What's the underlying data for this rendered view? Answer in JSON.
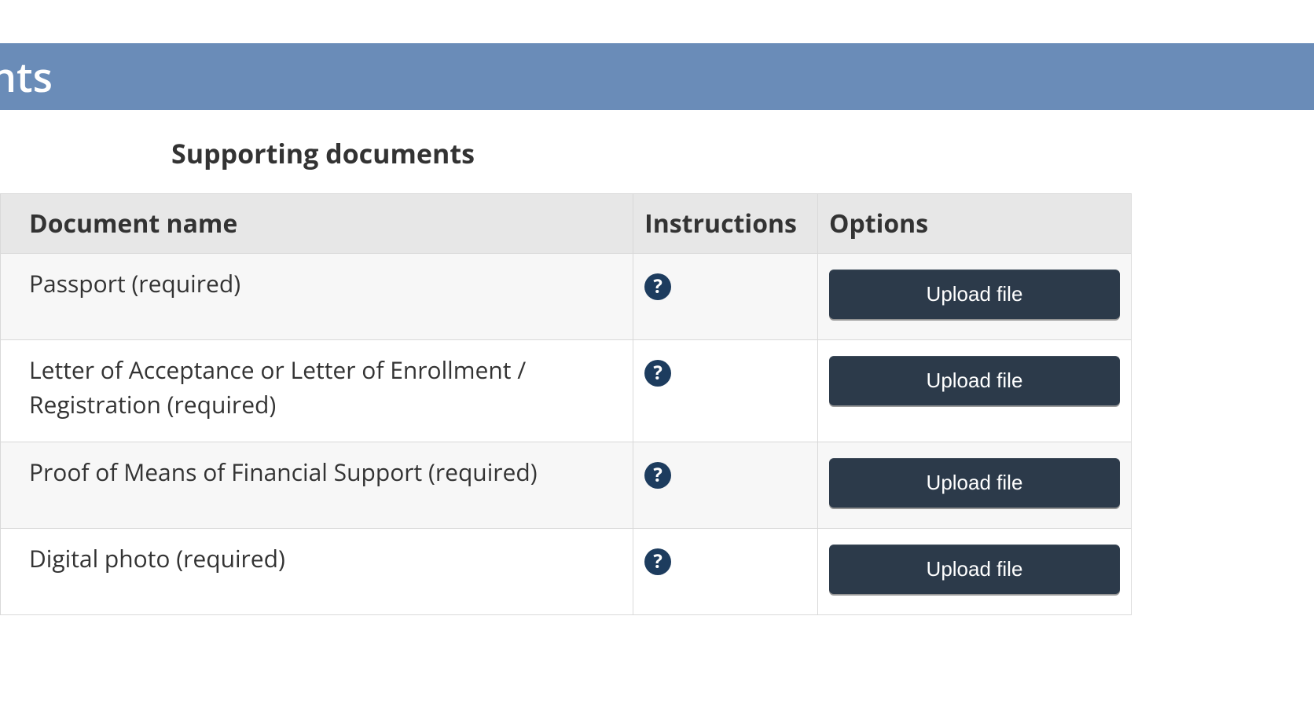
{
  "header": {
    "title_fragment": "nts"
  },
  "section": {
    "title": "Supporting documents"
  },
  "table": {
    "columns": {
      "document_name": "Document name",
      "instructions": "Instructions",
      "options": "Options"
    },
    "rows": [
      {
        "name": "Passport  (required)",
        "upload_label": "Upload file"
      },
      {
        "name": "Letter of Acceptance or Letter of Enrollment / Registration  (required)",
        "upload_label": "Upload file"
      },
      {
        "name": "Proof of Means of Financial Support  (required)",
        "upload_label": "Upload file"
      },
      {
        "name": "Digital photo  (required)",
        "upload_label": "Upload file"
      }
    ]
  },
  "icons": {
    "help_glyph": "?"
  }
}
